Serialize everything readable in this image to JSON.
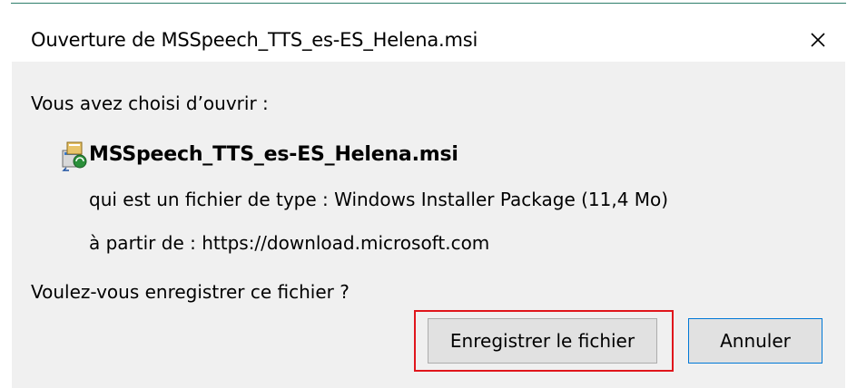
{
  "dialog": {
    "title": "Ouverture de MSSpeech_TTS_es-ES_Helena.msi",
    "close_icon": "close-icon"
  },
  "content": {
    "chose_label": "Vous avez choisi d’ouvrir :",
    "file_icon": "msi-installer-icon",
    "file_name": "MSSpeech_TTS_es-ES_Helena.msi",
    "file_type_line": "qui est un fichier de type :  Windows Installer Package (11,4 Mo)",
    "source_line": "à partir de :  https://download.microsoft.com",
    "question": "Voulez-vous enregistrer ce fichier ?"
  },
  "buttons": {
    "save_label": "Enregistrer le fichier",
    "cancel_label": "Annuler"
  },
  "colors": {
    "highlight_frame": "#e0161c",
    "default_button_border": "#0078d7",
    "panel_background": "#f0f0f0"
  }
}
